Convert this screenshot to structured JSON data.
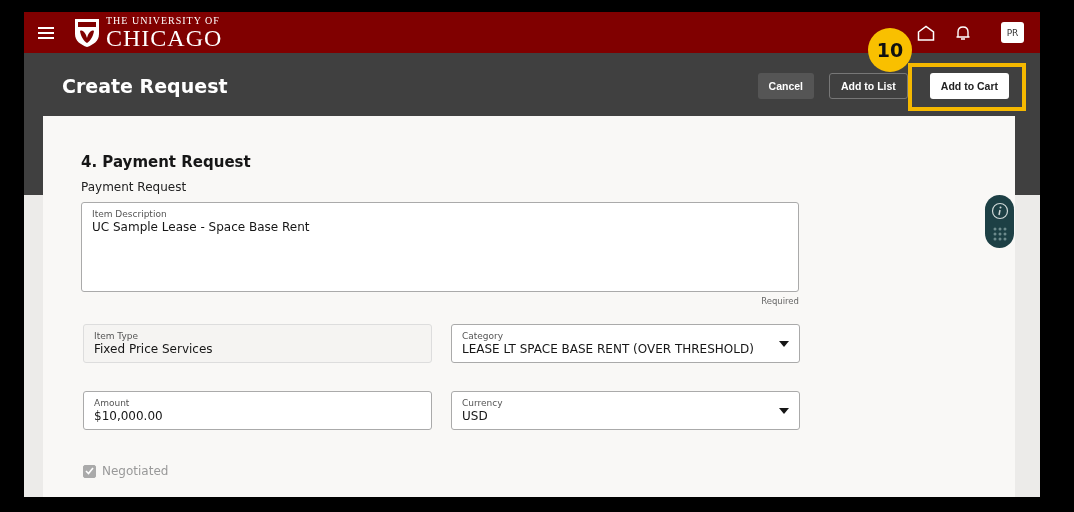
{
  "header": {
    "logo_top": "THE UNIVERSITY OF",
    "logo_main": "CHICAGO",
    "avatar": "PR"
  },
  "page": {
    "title": "Create Request",
    "buttons": [
      {
        "label": "Cancel",
        "kind": "secondary"
      },
      {
        "label": "Add to List",
        "kind": "outline"
      },
      {
        "label": "Add to Cart",
        "kind": "primary"
      }
    ]
  },
  "callout": {
    "number": "10"
  },
  "form": {
    "heading": "4. Payment Request",
    "subheading": "Payment Request",
    "description": {
      "label": "Item Description",
      "value": "UC Sample Lease - Space Base Rent",
      "hint": "Required"
    },
    "fields": [
      {
        "label": "Item Type",
        "value": "Fixed Price Services",
        "kind": "readonly"
      },
      {
        "label": "Category",
        "value": "LEASE LT SPACE BASE RENT (OVER THRESHOLD)",
        "kind": "select"
      },
      {
        "label": "Amount",
        "value": "$10,000.00",
        "kind": "input"
      },
      {
        "label": "Currency",
        "value": "USD",
        "kind": "select"
      }
    ],
    "negotiated": {
      "label": "Negotiated",
      "checked": true,
      "disabled": true
    }
  }
}
